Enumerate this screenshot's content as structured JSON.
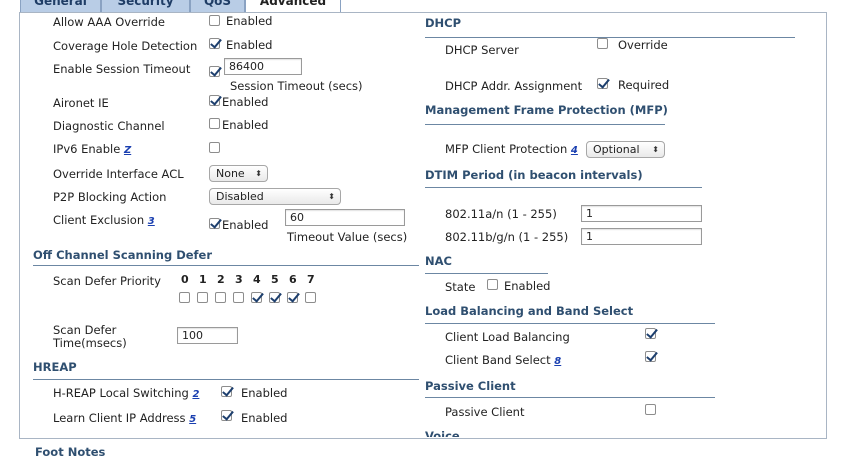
{
  "tabs": [
    "General",
    "Security",
    "QoS",
    "Advanced"
  ],
  "left": {
    "allow_aaa": {
      "label": "Allow AAA Override",
      "checked": false,
      "text": "Enabled"
    },
    "coverage_hole": {
      "label": "Coverage Hole Detection",
      "checked": true,
      "text": "Enabled"
    },
    "session_timeout": {
      "label": "Enable Session Timeout",
      "checked": true,
      "value": "86400",
      "caption": "Session Timeout (secs)"
    },
    "aironet_ie": {
      "label": "Aironet IE",
      "checked": true,
      "text": "Enabled"
    },
    "diag_channel": {
      "label": "Diagnostic Channel",
      "checked": false,
      "text": "Enabled"
    },
    "ipv6": {
      "label": "IPv6 Enable",
      "note": "Z",
      "checked": false
    },
    "override_acl": {
      "label": "Override Interface ACL",
      "value": "None"
    },
    "p2p": {
      "label": "P2P Blocking Action",
      "value": "Disabled"
    },
    "client_exclusion": {
      "label": "Client Exclusion",
      "note": "3",
      "checked": true,
      "text": "Enabled",
      "value": "60",
      "caption": "Timeout Value (secs)"
    },
    "off_channel_header": "Off Channel Scanning Defer",
    "scan_defer_priority": {
      "label": "Scan Defer Priority",
      "digits": [
        "0",
        "1",
        "2",
        "3",
        "4",
        "5",
        "6",
        "7"
      ],
      "checked": [
        false,
        false,
        false,
        false,
        true,
        true,
        true,
        false
      ]
    },
    "scan_defer_time": {
      "label_line1": "Scan Defer",
      "label_line2": "Time(msecs)",
      "value": "100"
    },
    "hreap_header": "HREAP",
    "hreap_local": {
      "label": "H-REAP Local Switching",
      "note": "2",
      "checked": true,
      "text": "Enabled"
    },
    "learn_ip": {
      "label": "Learn Client IP Address",
      "note": "5",
      "checked": true,
      "text": "Enabled"
    }
  },
  "right": {
    "dhcp_header": "DHCP",
    "dhcp_server": {
      "label": "DHCP Server",
      "checked": false,
      "text": "Override"
    },
    "dhcp_addr": {
      "label": "DHCP Addr. Assignment",
      "checked": true,
      "text": "Required"
    },
    "mfp_header": "Management Frame Protection (MFP)",
    "mfp_client": {
      "label": "MFP Client Protection",
      "note": "4",
      "value": "Optional"
    },
    "dtim_header": "DTIM Period (in beacon intervals)",
    "dtim_a": {
      "label": "802.11a/n (1 - 255)",
      "value": "1"
    },
    "dtim_b": {
      "label": "802.11b/g/n (1 - 255)",
      "value": "1"
    },
    "nac_header": "NAC",
    "nac_state": {
      "label": "State",
      "checked": false,
      "text": "Enabled"
    },
    "lb_header": "Load Balancing and Band Select",
    "client_lb": {
      "label": "Client Load Balancing",
      "checked": true
    },
    "client_band": {
      "label": "Client Band Select",
      "note": "8",
      "checked": true
    },
    "passive_header": "Passive Client",
    "passive_client": {
      "label": "Passive Client",
      "checked": false
    },
    "voice_header": "Voice"
  },
  "footnotes": "Foot Notes"
}
